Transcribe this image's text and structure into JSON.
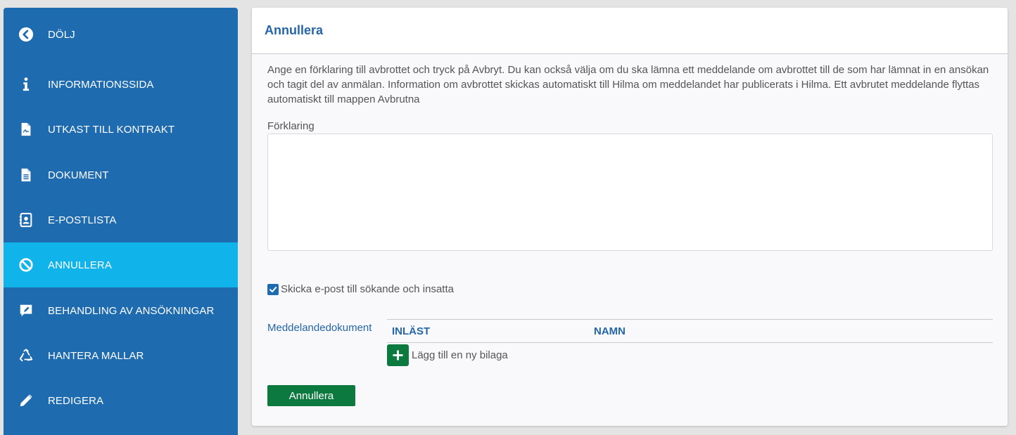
{
  "sidebar": {
    "items": [
      {
        "label": "DÖLJ",
        "icon": "chevron-left-circle-icon"
      },
      {
        "label": "INFORMATIONSSIDA",
        "icon": "info-icon"
      },
      {
        "label": "UTKAST TILL KONTRAKT",
        "icon": "pdf-file-icon"
      },
      {
        "label": "DOKUMENT",
        "icon": "document-icon"
      },
      {
        "label": "E-POSTLISTA",
        "icon": "contact-book-icon"
      },
      {
        "label": "ANNULLERA",
        "icon": "ban-icon",
        "active": true
      },
      {
        "label": "BEHANDLING AV ANSÖKNINGAR",
        "icon": "comment-edit-icon"
      },
      {
        "label": "HANTERA MALLAR",
        "icon": "recycle-icon"
      },
      {
        "label": "REDIGERA",
        "icon": "pencil-icon"
      }
    ]
  },
  "main": {
    "title": "Annullera",
    "description": "Ange en förklaring till avbrottet och tryck på Avbryt. Du kan också välja om du ska lämna ett meddelande om avbrottet till de som har lämnat in en ansökan och tagit del av anmälan. Information om avbrottet skickas automatiskt till Hilma om meddelandet har publicerats i Hilma. Ett avbrutet meddelande flyttas automatiskt till mappen Avbrutna",
    "explanation_label": "Förklaring",
    "explanation_value": "",
    "send_email_label": "Skicka e-post till sökande och insatta",
    "send_email_checked": true,
    "attachments_label": "Meddelandedokument",
    "attachments_columns": [
      "INLÄST",
      "NAMN"
    ],
    "add_attachment_label": "Lägg till en ny bilaga",
    "submit_label": "Annullera"
  },
  "colors": {
    "sidebar_bg": "#1e6bb0",
    "sidebar_active": "#10b3ea",
    "title_blue": "#2466a8",
    "button_green": "#0c7a3e"
  }
}
